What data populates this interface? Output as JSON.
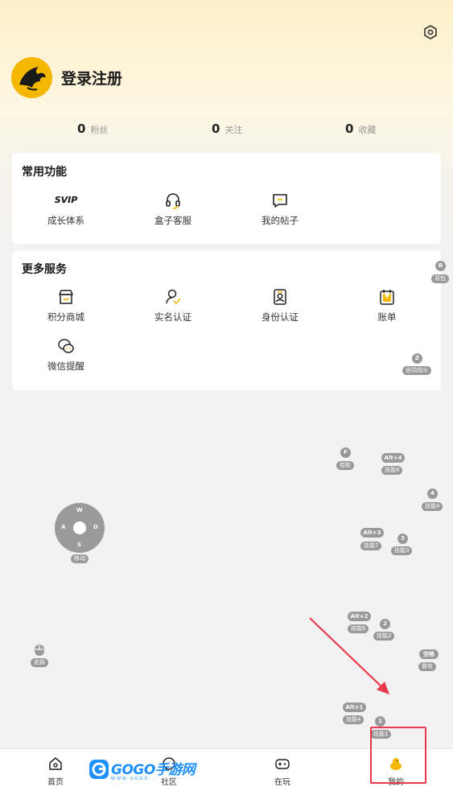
{
  "header": {
    "login_label": "登录注册"
  },
  "stats": [
    {
      "count": "0",
      "label": "粉丝"
    },
    {
      "count": "0",
      "label": "关注"
    },
    {
      "count": "0",
      "label": "收藏"
    }
  ],
  "common": {
    "title": "常用功能",
    "items": [
      {
        "label": "成长体系",
        "icon": "svip-icon",
        "icon_text": "SVIP"
      },
      {
        "label": "盒子客服",
        "icon": "headset-icon"
      },
      {
        "label": "我的帖子",
        "icon": "post-icon"
      }
    ]
  },
  "more": {
    "title": "更多服务",
    "items": [
      {
        "label": "积分商城",
        "icon": "store-icon"
      },
      {
        "label": "实名认证",
        "icon": "user-check-icon"
      },
      {
        "label": "身份认证",
        "icon": "id-badge-icon"
      },
      {
        "label": "账单",
        "icon": "bill-icon",
        "icon_text": "¥"
      },
      {
        "label": "微信提醒",
        "icon": "wechat-icon"
      }
    ]
  },
  "controls": {
    "dpad": {
      "up": "W",
      "left": "A",
      "right": "D",
      "down": "S",
      "label": "移动"
    },
    "keys": [
      {
        "key": "B",
        "label": "背包"
      },
      {
        "key": "Z",
        "label": "自动战斗"
      },
      {
        "key": "F",
        "label": "拾取"
      },
      {
        "key": "Alt+4",
        "label": "技能8"
      },
      {
        "key": "4",
        "label": "技能4"
      },
      {
        "key": "Alt+3",
        "label": "技能7"
      },
      {
        "key": "3",
        "label": "技能3"
      },
      {
        "key": "Alt+2",
        "label": "技能6"
      },
      {
        "key": "2",
        "label": "技能2"
      },
      {
        "key": "空格",
        "label": "普攻"
      },
      {
        "key": "Alt+1",
        "label": "技能4"
      },
      {
        "key": "1",
        "label": "技能1"
      }
    ],
    "mouse_label": "走路"
  },
  "watermark": {
    "text": "GOGO手游网",
    "sub": "WWW.GOGO..."
  },
  "nav": [
    {
      "label": "首页",
      "icon": "home-icon"
    },
    {
      "label": "社区",
      "icon": "community-icon"
    },
    {
      "label": "在玩",
      "icon": "gamepad-icon"
    },
    {
      "label": "我的",
      "icon": "profile-duck-icon"
    }
  ],
  "colors": {
    "accent": "#f5b800",
    "highlight": "#e8384f",
    "arrow": "#e8384f"
  }
}
